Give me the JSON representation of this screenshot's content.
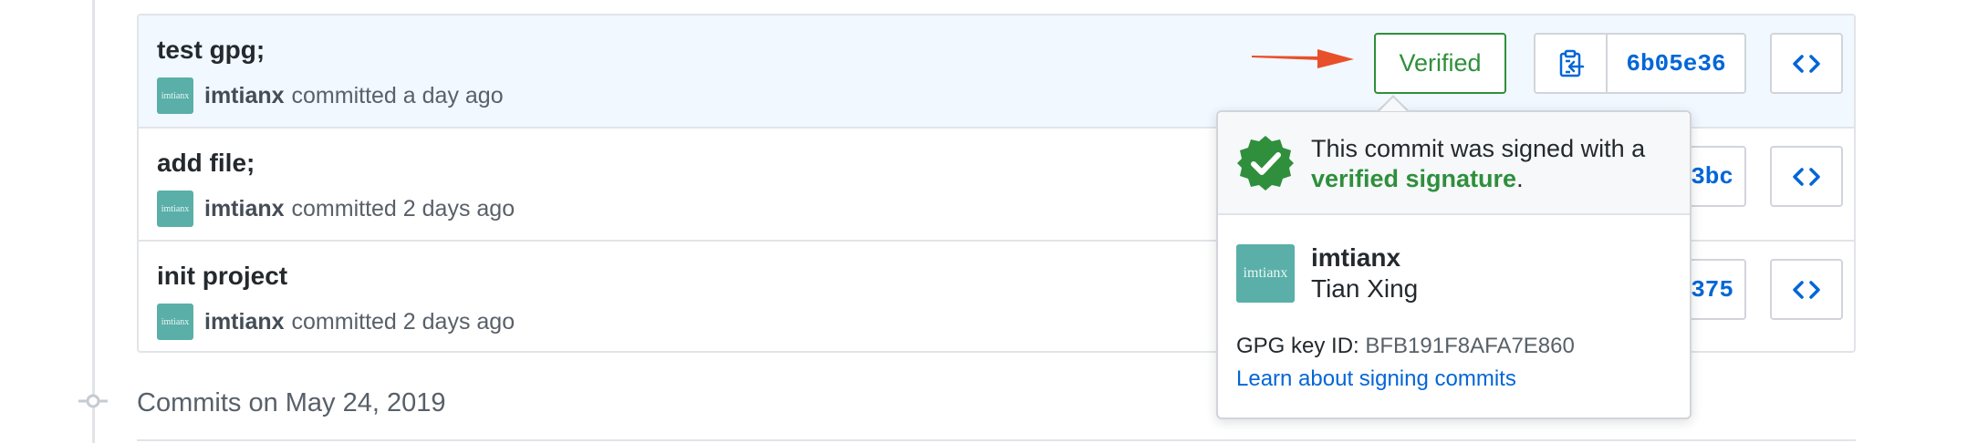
{
  "commits": [
    {
      "title": "test gpg;",
      "avatar_text": "imtianx",
      "author": "imtianx",
      "when": "committed a day ago",
      "badge": "Verified",
      "sha": "6b05e36"
    },
    {
      "title": "add file;",
      "avatar_text": "imtianx",
      "author": "imtianx",
      "when": "committed 2 days ago",
      "sha_tail": "3bc"
    },
    {
      "title": "init project",
      "avatar_text": "imtianx",
      "author": "imtianx",
      "when": "committed 2 days ago",
      "sha_tail": "375"
    }
  ],
  "section": {
    "label": "Commits on May 24, 2019"
  },
  "popover": {
    "message_prefix": "This commit was signed with a",
    "message_highlight": "verified signature",
    "message_suffix": ".",
    "avatar_text": "imtianx",
    "login": "imtianx",
    "full_name": "Tian Xing",
    "gpg_label": "GPG key ID:",
    "gpg_key": "BFB191F8AFA7E860",
    "learn_link": "Learn about signing commits"
  },
  "colors": {
    "verified": "#2f8f3c",
    "link": "#0366d6",
    "annotation_arrow": "#e8502a",
    "avatar_bg": "#5aafa8"
  },
  "icons": [
    "clipboard-copy-icon",
    "code-brackets-icon",
    "verified-check-badge-icon",
    "commit-node-icon",
    "red-arrow-annotation"
  ]
}
